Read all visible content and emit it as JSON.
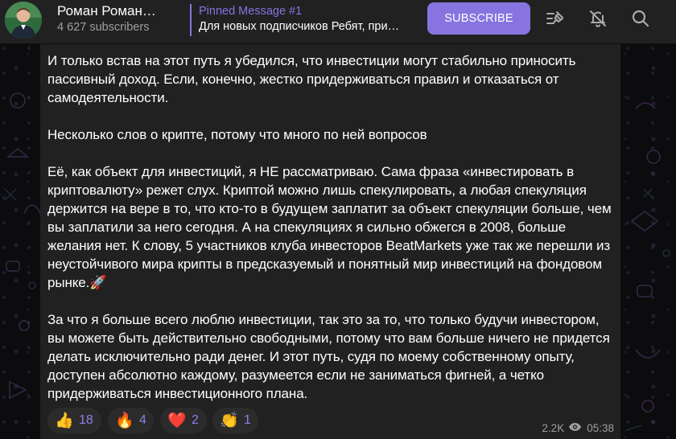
{
  "header": {
    "channel_title": "Роман Роман…",
    "subscribers": "4 627 subscribers",
    "pinned_title": "Pinned Message #1",
    "pinned_text": "Для новых подписчиков Ребят, при…",
    "subscribe_label": "SUBSCRIBE",
    "icons": [
      "avatar",
      "pinned-list-icon",
      "bell-muted-icon",
      "search-icon"
    ]
  },
  "message": {
    "paragraphs": [
      "И только встав на этот путь я убедился, что инвестиции могут стабильно приносить пассивный доход. Если, конечно, жестко придерживаться правил и отказаться от самодеятельности.",
      "Несколько слов о крипте, потому что много по ней вопросов",
      "Её, как объект для инвестиций, я НЕ рассматриваю. Сама фраза «инвестировать в криптовалюту» режет слух. Криптой можно лишь спекулировать, а любая спекуляция держится на вере в то, что кто-то в будущем заплатит за объект спекуляции больше, чем вы заплатили за него сегодня. А на спекуляциях я сильно обжегся в 2008, больше желания нет. К слову, 5 участников клуба инвесторов BeatMarkets уже так же перешли из неустойчивого мира крипты в предсказуемый и понятный мир инвестиций на фондовом рынке.🚀",
      "За что я больше всего люблю инвестиции, так это за то, что только будучи инвестором, вы можете быть действительно свободными, потому что вам больше ничего не придется делать исключительно ради денег. И этот путь, судя по моему собственному опыту, доступен абсолютно каждому, разумеется если не заниматься фигней, а четко придерживаться инвестиционного плана."
    ],
    "reactions": [
      {
        "emoji": "👍",
        "count": "18"
      },
      {
        "emoji": "🔥",
        "count": "4"
      },
      {
        "emoji": "❤️",
        "count": "2"
      },
      {
        "emoji": "👏",
        "count": "1"
      }
    ],
    "views": "2.2K",
    "time": "05:38"
  },
  "colors": {
    "accent": "#8774e1",
    "header_bg": "#212121",
    "bubble_bg": "#212121",
    "muted_text": "#9e9e9e"
  }
}
